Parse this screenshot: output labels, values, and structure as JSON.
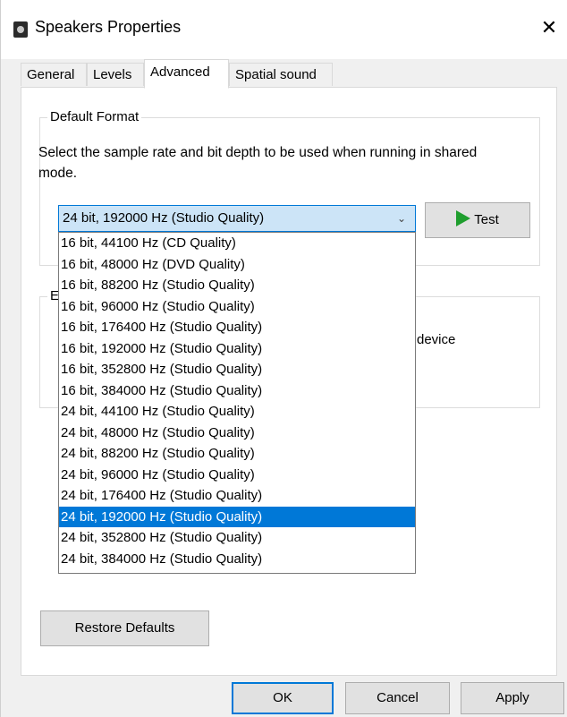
{
  "window": {
    "title": "Speakers Properties",
    "close_glyph": "✕"
  },
  "tabs": [
    {
      "label": "General"
    },
    {
      "label": "Levels"
    },
    {
      "label": "Advanced"
    },
    {
      "label": "Spatial sound"
    }
  ],
  "default_format": {
    "legend": "Default Format",
    "description": "Select the sample rate and bit depth to be used when running in shared mode.",
    "selected": "24 bit, 192000 Hz (Studio Quality)",
    "test_label": "Test",
    "options": [
      "16 bit, 44100 Hz (CD Quality)",
      "16 bit, 48000 Hz (DVD Quality)",
      "16 bit, 88200 Hz (Studio Quality)",
      "16 bit, 96000 Hz (Studio Quality)",
      "16 bit, 176400 Hz (Studio Quality)",
      "16 bit, 192000 Hz (Studio Quality)",
      "16 bit, 352800 Hz (Studio Quality)",
      "16 bit, 384000 Hz (Studio Quality)",
      "24 bit, 44100 Hz (Studio Quality)",
      "24 bit, 48000 Hz (Studio Quality)",
      "24 bit, 88200 Hz (Studio Quality)",
      "24 bit, 96000 Hz (Studio Quality)",
      "24 bit, 176400 Hz (Studio Quality)",
      "24 bit, 192000 Hz (Studio Quality)",
      "24 bit, 352800 Hz (Studio Quality)",
      "24 bit, 384000 Hz (Studio Quality)"
    ],
    "selected_index": 13
  },
  "exclusive": {
    "legend_partial": "Ex",
    "text_partial": "device"
  },
  "restore_defaults_label": "Restore Defaults",
  "footer": {
    "ok": "OK",
    "cancel": "Cancel",
    "apply": "Apply"
  },
  "colors": {
    "accent": "#0078d7",
    "test_icon": "#1f9e2e"
  },
  "icons": {
    "app": "speaker-icon",
    "test": "play-icon",
    "combo": "chevron-down-icon"
  }
}
